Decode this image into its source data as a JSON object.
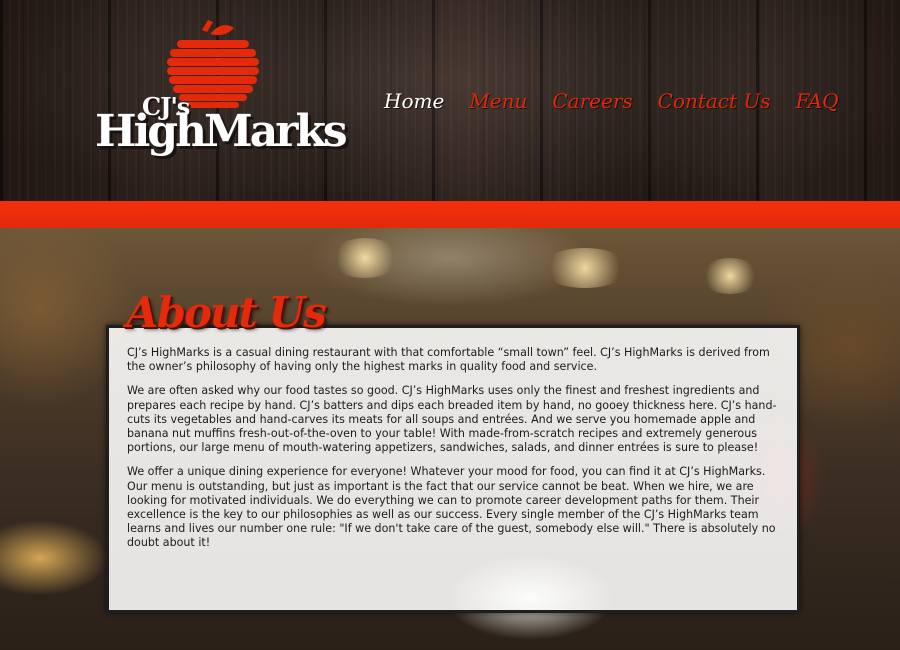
{
  "brand": {
    "cjs": "CJ's",
    "name": "HighMarks",
    "logo_color": "#e42a0b"
  },
  "nav": {
    "items": [
      {
        "label": "Home",
        "active": true
      },
      {
        "label": "Menu",
        "active": false
      },
      {
        "label": "Careers",
        "active": false
      },
      {
        "label": "Contact Us",
        "active": false
      },
      {
        "label": "FAQ",
        "active": false
      }
    ],
    "active_color": "#ffffff",
    "link_color": "#e0280c"
  },
  "accent_color": "#e42a0b",
  "about": {
    "title": "About Us",
    "paragraphs": [
      "CJ’s HighMarks is a casual dining restaurant with that comfortable “small town” feel. CJ’s HighMarks is derived from the owner’s philosophy of having only the highest marks in quality food and service.",
      "We are often asked why our food tastes so good. CJ’s HighMarks uses only the finest and freshest ingredients and prepares each recipe by hand.  CJ’s batters and dips each breaded item by hand, no gooey thickness here. CJ’s hand-cuts its vegetables and hand-carves its meats for all soups and entrées. And we serve you homemade apple and banana nut muffins fresh-out-of-the-oven to your table! With made-from-scratch recipes and extremely generous portions, our large menu of mouth-watering appetizers, sandwiches, salads, and dinner entrées is sure to please!",
      "We offer a unique dining experience for everyone!  Whatever your mood for food, you can find it at CJ’s HighMarks.  Our menu is outstanding, but just as important is the fact that our service cannot be beat.  When we hire, we are looking for motivated individuals. We do everything we can to promote career development paths for them.  Their excellence is the key to our philosophies as well as our success.  Every single member of the CJ’s HighMarks team learns and lives our number one rule: \"If we don't take care of the guest, somebody else will.\"  There is absolutely no doubt about it!"
    ]
  }
}
